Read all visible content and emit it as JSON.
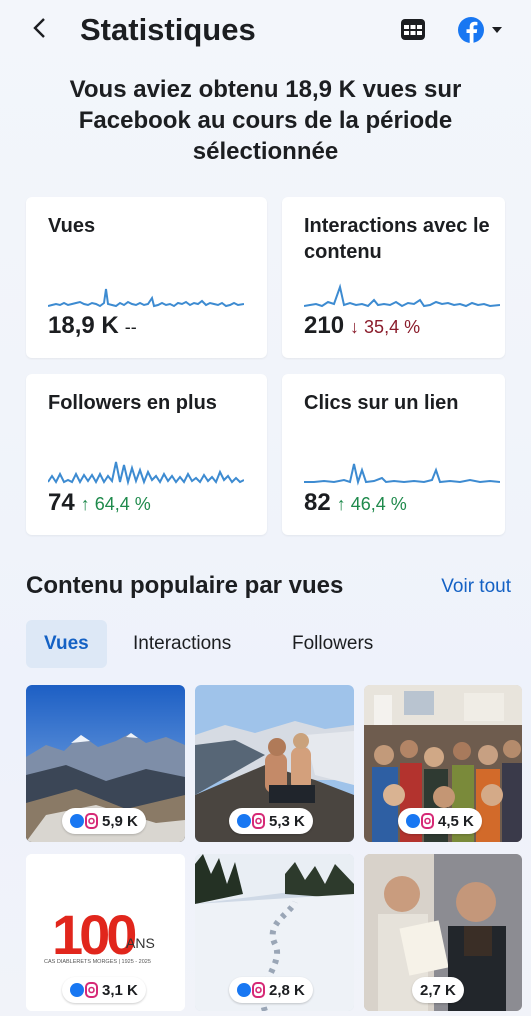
{
  "header": {
    "back_icon": "chevron-left-icon",
    "title": "Statistiques",
    "calendar_icon": "calendar-icon",
    "account_icon": "facebook-icon",
    "dropdown_icon": "caret-down-icon"
  },
  "headline": "Vous aviez obtenu 18,9 K vues sur Facebook au cours de la période sélectionnée",
  "cards": [
    {
      "label": "Vues",
      "value": "18,9 K",
      "delta": "--",
      "trend": "none"
    },
    {
      "label": "Interactions avec le contenu",
      "value": "210",
      "delta": "↓ 35,4 %",
      "trend": "down"
    },
    {
      "label": "Followers en plus",
      "value": "74",
      "delta": "↑ 64,4 %",
      "trend": "up"
    },
    {
      "label": "Clics sur un lien",
      "value": "82",
      "delta": "↑ 46,4 %",
      "trend": "up"
    }
  ],
  "popular": {
    "title": "Contenu populaire par vues",
    "see_all": "Voir tout",
    "tabs": [
      "Vues",
      "Interactions",
      "Followers"
    ],
    "active_tab": "Vues",
    "items": [
      {
        "views": "5,9 K",
        "platforms": "facebook-instagram-icon",
        "image": "mountain-range-blue-sky"
      },
      {
        "views": "5,3 K",
        "platforms": "facebook-instagram-icon",
        "image": "climbers-on-summit"
      },
      {
        "views": "4,5 K",
        "platforms": "facebook-instagram-icon",
        "image": "crowded-assembly-hall"
      },
      {
        "views": "3,1 K",
        "platforms": "facebook-instagram-icon",
        "image": "100-ans-logo"
      },
      {
        "views": "2,8 K",
        "platforms": "facebook-instagram-icon",
        "image": "snow-footprints-trail"
      },
      {
        "views": "2,7 K",
        "platforms": "",
        "image": "two-men-with-certificate"
      }
    ],
    "logo": {
      "big": "100",
      "sub": "ANS",
      "caption": "CAS DIABLERETS MORGES | 1925 - 2025"
    }
  },
  "colors": {
    "accent": "#1461c4",
    "spark": "#3d8bd1",
    "down": "#8a1c2b",
    "up": "#1f8a4c",
    "logo_red": "#e1261c"
  }
}
